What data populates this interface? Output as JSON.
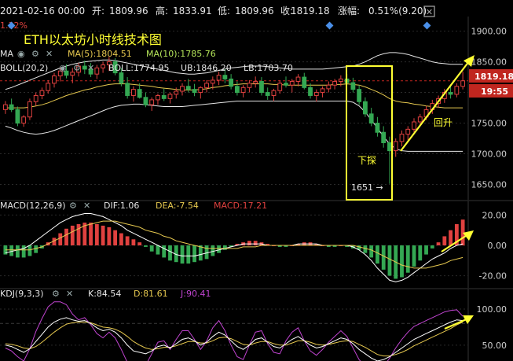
{
  "header": {
    "date": "2021-02-16 00:00",
    "open_label": "开:",
    "open": "1809.96",
    "high_label": "高:",
    "high": "1833.91",
    "low_label": "低:",
    "low": "1809.96",
    "close_label": "收:",
    "close": "1819.18",
    "change_label": "涨幅:",
    "change": "0.51%(9.20)",
    "prev_change": "1.32%"
  },
  "main": {
    "title": "ETH以太坊小时线技术图",
    "ma_label": "MA",
    "ma5": "MA(5):1804.51",
    "ma10": "MA(10):1785.76",
    "boll_label": "BOLL(20,2)",
    "boll": "BOLL:1774.95",
    "ub": "UB:1846.20",
    "lb": "LB:1703.70",
    "ann_down": "下探",
    "ann_up": "回升",
    "ann_low": "1651 →",
    "price_tag": "1819.18",
    "time_tag": "19:55"
  },
  "macd": {
    "label": "MACD(12,26,9)",
    "dif": "DIF:1.06",
    "dea": "DEA:-7.54",
    "macd": "MACD:17.21"
  },
  "kdj": {
    "label": "KDJ(9,3,3)",
    "k": "K:84.54",
    "d": "D:81.61",
    "j": "J:90.41"
  },
  "colors": {
    "up": "#e0413f",
    "down": "#34a853",
    "dif": "#ffffff",
    "dea": "#e6c84f",
    "j": "#c044d0",
    "annotation": "#ffff33",
    "accent": "#4a8fe8",
    "price_tag_bg": "#c0261f"
  },
  "chart_data": [
    {
      "type": "candlestick",
      "title": "ETH以太坊小时线技术图",
      "ylim": [
        1625,
        1920
      ],
      "y_ticks": [
        "1900.00",
        "1850.00",
        "1800.00",
        "1750.00",
        "1700.00",
        "1650.00"
      ],
      "y_tick_values": [
        1900,
        1850,
        1800,
        1750,
        1700,
        1650
      ],
      "candles": [
        [
          1772,
          1786,
          1765,
          1780
        ],
        [
          1780,
          1790,
          1768,
          1772
        ],
        [
          1772,
          1777,
          1745,
          1750
        ],
        [
          1750,
          1763,
          1744,
          1760
        ],
        [
          1760,
          1790,
          1755,
          1785
        ],
        [
          1785,
          1800,
          1778,
          1795
        ],
        [
          1795,
          1808,
          1789,
          1803
        ],
        [
          1803,
          1820,
          1798,
          1815
        ],
        [
          1815,
          1832,
          1808,
          1827
        ],
        [
          1827,
          1840,
          1818,
          1835
        ],
        [
          1835,
          1846,
          1823,
          1828
        ],
        [
          1828,
          1840,
          1815,
          1833
        ],
        [
          1833,
          1848,
          1826,
          1843
        ],
        [
          1843,
          1852,
          1830,
          1838
        ],
        [
          1838,
          1848,
          1825,
          1830
        ],
        [
          1830,
          1845,
          1822,
          1840
        ],
        [
          1840,
          1850,
          1832,
          1845
        ],
        [
          1845,
          1858,
          1835,
          1850
        ],
        [
          1850,
          1856,
          1828,
          1832
        ],
        [
          1832,
          1840,
          1810,
          1815
        ],
        [
          1815,
          1825,
          1790,
          1795
        ],
        [
          1795,
          1810,
          1785,
          1805
        ],
        [
          1805,
          1815,
          1790,
          1792
        ],
        [
          1792,
          1800,
          1776,
          1780
        ],
        [
          1780,
          1792,
          1770,
          1788
        ],
        [
          1788,
          1798,
          1780,
          1795
        ],
        [
          1795,
          1806,
          1786,
          1790
        ],
        [
          1790,
          1800,
          1782,
          1797
        ],
        [
          1797,
          1808,
          1790,
          1802
        ],
        [
          1802,
          1815,
          1795,
          1810
        ],
        [
          1810,
          1822,
          1800,
          1805
        ],
        [
          1805,
          1814,
          1794,
          1800
        ],
        [
          1800,
          1810,
          1790,
          1808
        ],
        [
          1808,
          1820,
          1800,
          1815
        ],
        [
          1815,
          1826,
          1805,
          1820
        ],
        [
          1820,
          1834,
          1812,
          1828
        ],
        [
          1828,
          1838,
          1815,
          1822
        ],
        [
          1822,
          1830,
          1805,
          1810
        ],
        [
          1810,
          1818,
          1795,
          1800
        ],
        [
          1800,
          1812,
          1792,
          1808
        ],
        [
          1808,
          1820,
          1800,
          1815
        ],
        [
          1815,
          1826,
          1808,
          1818
        ],
        [
          1818,
          1825,
          1795,
          1800
        ],
        [
          1800,
          1808,
          1788,
          1795
        ],
        [
          1795,
          1806,
          1786,
          1803
        ],
        [
          1803,
          1820,
          1798,
          1815
        ],
        [
          1815,
          1826,
          1808,
          1812
        ],
        [
          1812,
          1822,
          1800,
          1818
        ],
        [
          1818,
          1830,
          1810,
          1825
        ],
        [
          1825,
          1832,
          1805,
          1808
        ],
        [
          1808,
          1815,
          1790,
          1795
        ],
        [
          1795,
          1805,
          1785,
          1800
        ],
        [
          1800,
          1810,
          1792,
          1806
        ],
        [
          1806,
          1818,
          1800,
          1812
        ],
        [
          1812,
          1822,
          1805,
          1818
        ],
        [
          1818,
          1828,
          1810,
          1822
        ],
        [
          1822,
          1830,
          1812,
          1816
        ],
        [
          1816,
          1824,
          1800,
          1805
        ],
        [
          1805,
          1812,
          1780,
          1785
        ],
        [
          1785,
          1792,
          1760,
          1765
        ],
        [
          1765,
          1775,
          1745,
          1750
        ],
        [
          1750,
          1760,
          1728,
          1735
        ],
        [
          1735,
          1745,
          1710,
          1718
        ],
        [
          1718,
          1728,
          1651,
          1705
        ],
        [
          1705,
          1725,
          1695,
          1720
        ],
        [
          1720,
          1738,
          1712,
          1732
        ],
        [
          1732,
          1745,
          1722,
          1740
        ],
        [
          1740,
          1758,
          1735,
          1752
        ],
        [
          1752,
          1765,
          1745,
          1760
        ],
        [
          1760,
          1778,
          1755,
          1772
        ],
        [
          1772,
          1788,
          1765,
          1782
        ],
        [
          1782,
          1795,
          1775,
          1790
        ],
        [
          1790,
          1806,
          1783,
          1800
        ],
        [
          1800,
          1812,
          1790,
          1797
        ],
        [
          1797,
          1815,
          1792,
          1810
        ],
        [
          1810,
          1834,
          1805,
          1819
        ]
      ],
      "ub": [
        1805,
        1808,
        1812,
        1816,
        1820,
        1824,
        1828,
        1832,
        1836,
        1840,
        1843,
        1846,
        1848,
        1850,
        1851,
        1852,
        1853,
        1853,
        1852,
        1850,
        1848,
        1846,
        1844,
        1842,
        1840,
        1838,
        1836,
        1834,
        1832,
        1831,
        1830,
        1830,
        1831,
        1832,
        1834,
        1836,
        1838,
        1840,
        1841,
        1842,
        1843,
        1843,
        1843,
        1842,
        1841,
        1840,
        1839,
        1838,
        1838,
        1838,
        1838,
        1838,
        1838,
        1839,
        1840,
        1841,
        1842,
        1843,
        1846,
        1850,
        1855,
        1860,
        1863,
        1865,
        1865,
        1864,
        1862,
        1859,
        1856,
        1853,
        1850,
        1848,
        1847,
        1846,
        1846,
        1846
      ],
      "lb": [
        1745,
        1742,
        1738,
        1735,
        1733,
        1732,
        1733,
        1735,
        1738,
        1742,
        1746,
        1750,
        1754,
        1758,
        1762,
        1766,
        1770,
        1774,
        1777,
        1779,
        1780,
        1781,
        1781,
        1780,
        1779,
        1778,
        1777,
        1777,
        1777,
        1777,
        1778,
        1779,
        1780,
        1781,
        1782,
        1783,
        1784,
        1785,
        1786,
        1786,
        1786,
        1786,
        1786,
        1786,
        1786,
        1786,
        1786,
        1786,
        1786,
        1786,
        1786,
        1786,
        1786,
        1786,
        1786,
        1786,
        1786,
        1784,
        1778,
        1768,
        1755,
        1742,
        1728,
        1716,
        1708,
        1705,
        1704,
        1704,
        1704,
        1704,
        1704,
        1704,
        1704,
        1704,
        1704,
        1704
      ],
      "boll_mid": [
        1775,
        1775,
        1775,
        1775,
        1776,
        1778,
        1780,
        1783,
        1787,
        1791,
        1795,
        1798,
        1801,
        1804,
        1806,
        1809,
        1811,
        1813,
        1814,
        1814,
        1814,
        1813,
        1812,
        1811,
        1810,
        1808,
        1807,
        1806,
        1805,
        1804,
        1804,
        1804,
        1805,
        1806,
        1808,
        1809,
        1811,
        1812,
        1813,
        1814,
        1814,
        1814,
        1814,
        1814,
        1813,
        1813,
        1812,
        1812,
        1812,
        1812,
        1812,
        1812,
        1812,
        1812,
        1813,
        1813,
        1814,
        1813,
        1812,
        1809,
        1805,
        1801,
        1796,
        1790,
        1786,
        1784,
        1783,
        1781,
        1780,
        1778,
        1777,
        1776,
        1775,
        1775,
        1775,
        1775
      ],
      "annotations": [
        "下探",
        "回升",
        "1651 →"
      ]
    },
    {
      "type": "bar",
      "name_label": "MACD(12,26,9)",
      "ylim": [
        -28,
        28
      ],
      "y_ticks": [
        "20.00",
        "0.00",
        "-20.00"
      ],
      "y_tick_values": [
        20,
        0,
        -20
      ],
      "hist": [
        -6,
        -7,
        -8,
        -8,
        -7,
        -5,
        -2,
        2,
        5,
        8,
        11,
        13,
        14,
        15,
        15,
        14,
        13,
        12,
        10,
        8,
        6,
        4,
        2,
        -1,
        -4,
        -6,
        -8,
        -10,
        -11,
        -12,
        -12,
        -11,
        -10,
        -9,
        -7,
        -5,
        -3,
        -1,
        1,
        2,
        3,
        3,
        2,
        1,
        0,
        -1,
        -1,
        0,
        1,
        2,
        2,
        1,
        0,
        -1,
        -1,
        0,
        -1,
        -2,
        -3,
        -5,
        -8,
        -12,
        -16,
        -20,
        -22,
        -21,
        -18,
        -14,
        -10,
        -6,
        -2,
        2,
        6,
        10,
        14,
        17
      ],
      "dif": [
        -5,
        -4,
        -3,
        -2,
        0,
        3,
        6,
        9,
        12,
        15,
        17,
        19,
        20,
        21,
        21,
        20,
        19,
        17,
        15,
        13,
        10,
        8,
        6,
        4,
        2,
        0,
        -2,
        -4,
        -6,
        -7,
        -7,
        -7,
        -6,
        -5,
        -4,
        -3,
        -2,
        -1,
        0,
        1,
        1,
        1,
        1,
        0,
        0,
        0,
        0,
        0,
        1,
        1,
        1,
        1,
        0,
        0,
        0,
        0,
        0,
        -1,
        -3,
        -6,
        -10,
        -15,
        -19,
        -23,
        -24,
        -23,
        -21,
        -18,
        -15,
        -12,
        -9,
        -7,
        -5,
        -2,
        0,
        1
      ],
      "dea": [
        -3,
        -3,
        -3,
        -3,
        -3,
        -2,
        -1,
        1,
        3,
        5,
        7,
        9,
        11,
        13,
        14,
        15,
        16,
        16,
        16,
        15,
        14,
        13,
        12,
        10,
        9,
        8,
        6,
        5,
        3,
        2,
        1,
        0,
        -1,
        -2,
        -2,
        -2,
        -2,
        -2,
        -2,
        -1,
        -1,
        -1,
        0,
        0,
        0,
        0,
        0,
        0,
        0,
        0,
        0,
        0,
        0,
        0,
        0,
        0,
        0,
        0,
        -1,
        -2,
        -3,
        -5,
        -7,
        -9,
        -11,
        -13,
        -14,
        -15,
        -15,
        -15,
        -14,
        -13,
        -12,
        -10,
        -9,
        -8
      ]
    },
    {
      "type": "line",
      "name_label": "KDJ(9,3,3)",
      "ylim": [
        28,
        125
      ],
      "y_ticks": [
        "100.00",
        "50.00"
      ],
      "y_tick_values": [
        100,
        50
      ],
      "k": [
        50,
        48,
        44,
        40,
        45,
        55,
        65,
        75,
        82,
        86,
        88,
        85,
        83,
        84,
        80,
        74,
        70,
        72,
        68,
        60,
        50,
        42,
        40,
        38,
        42,
        48,
        50,
        46,
        52,
        58,
        60,
        56,
        50,
        54,
        62,
        68,
        64,
        56,
        48,
        44,
        50,
        58,
        60,
        54,
        48,
        46,
        52,
        58,
        62,
        56,
        50,
        46,
        48,
        52,
        56,
        60,
        58,
        52,
        44,
        38,
        32,
        28,
        30,
        34,
        40,
        46,
        52,
        58,
        62,
        66,
        70,
        74,
        78,
        82,
        85,
        84
      ],
      "d": [
        52,
        51,
        49,
        46,
        45,
        48,
        54,
        61,
        68,
        74,
        79,
        81,
        82,
        82,
        81,
        78,
        75,
        74,
        72,
        68,
        62,
        55,
        50,
        46,
        44,
        45,
        47,
        47,
        49,
        52,
        55,
        55,
        53,
        53,
        56,
        60,
        61,
        59,
        55,
        51,
        50,
        53,
        55,
        55,
        52,
        50,
        50,
        53,
        56,
        56,
        54,
        51,
        50,
        51,
        53,
        55,
        56,
        55,
        51,
        47,
        42,
        37,
        35,
        35,
        37,
        40,
        44,
        49,
        53,
        57,
        61,
        65,
        69,
        73,
        78,
        82
      ],
      "j": [
        46,
        42,
        34,
        28,
        45,
        69,
        87,
        103,
        110,
        110,
        106,
        93,
        85,
        88,
        78,
        66,
        60,
        68,
        60,
        44,
        26,
        16,
        20,
        22,
        38,
        54,
        56,
        44,
        58,
        70,
        70,
        58,
        44,
        56,
        74,
        84,
        70,
        50,
        34,
        30,
        50,
        68,
        70,
        52,
        40,
        38,
        56,
        68,
        74,
        56,
        42,
        36,
        44,
        54,
        62,
        70,
        62,
        46,
        30,
        20,
        12,
        10,
        20,
        32,
        46,
        58,
        68,
        76,
        80,
        84,
        88,
        92,
        96,
        98,
        99,
        90
      ]
    }
  ]
}
